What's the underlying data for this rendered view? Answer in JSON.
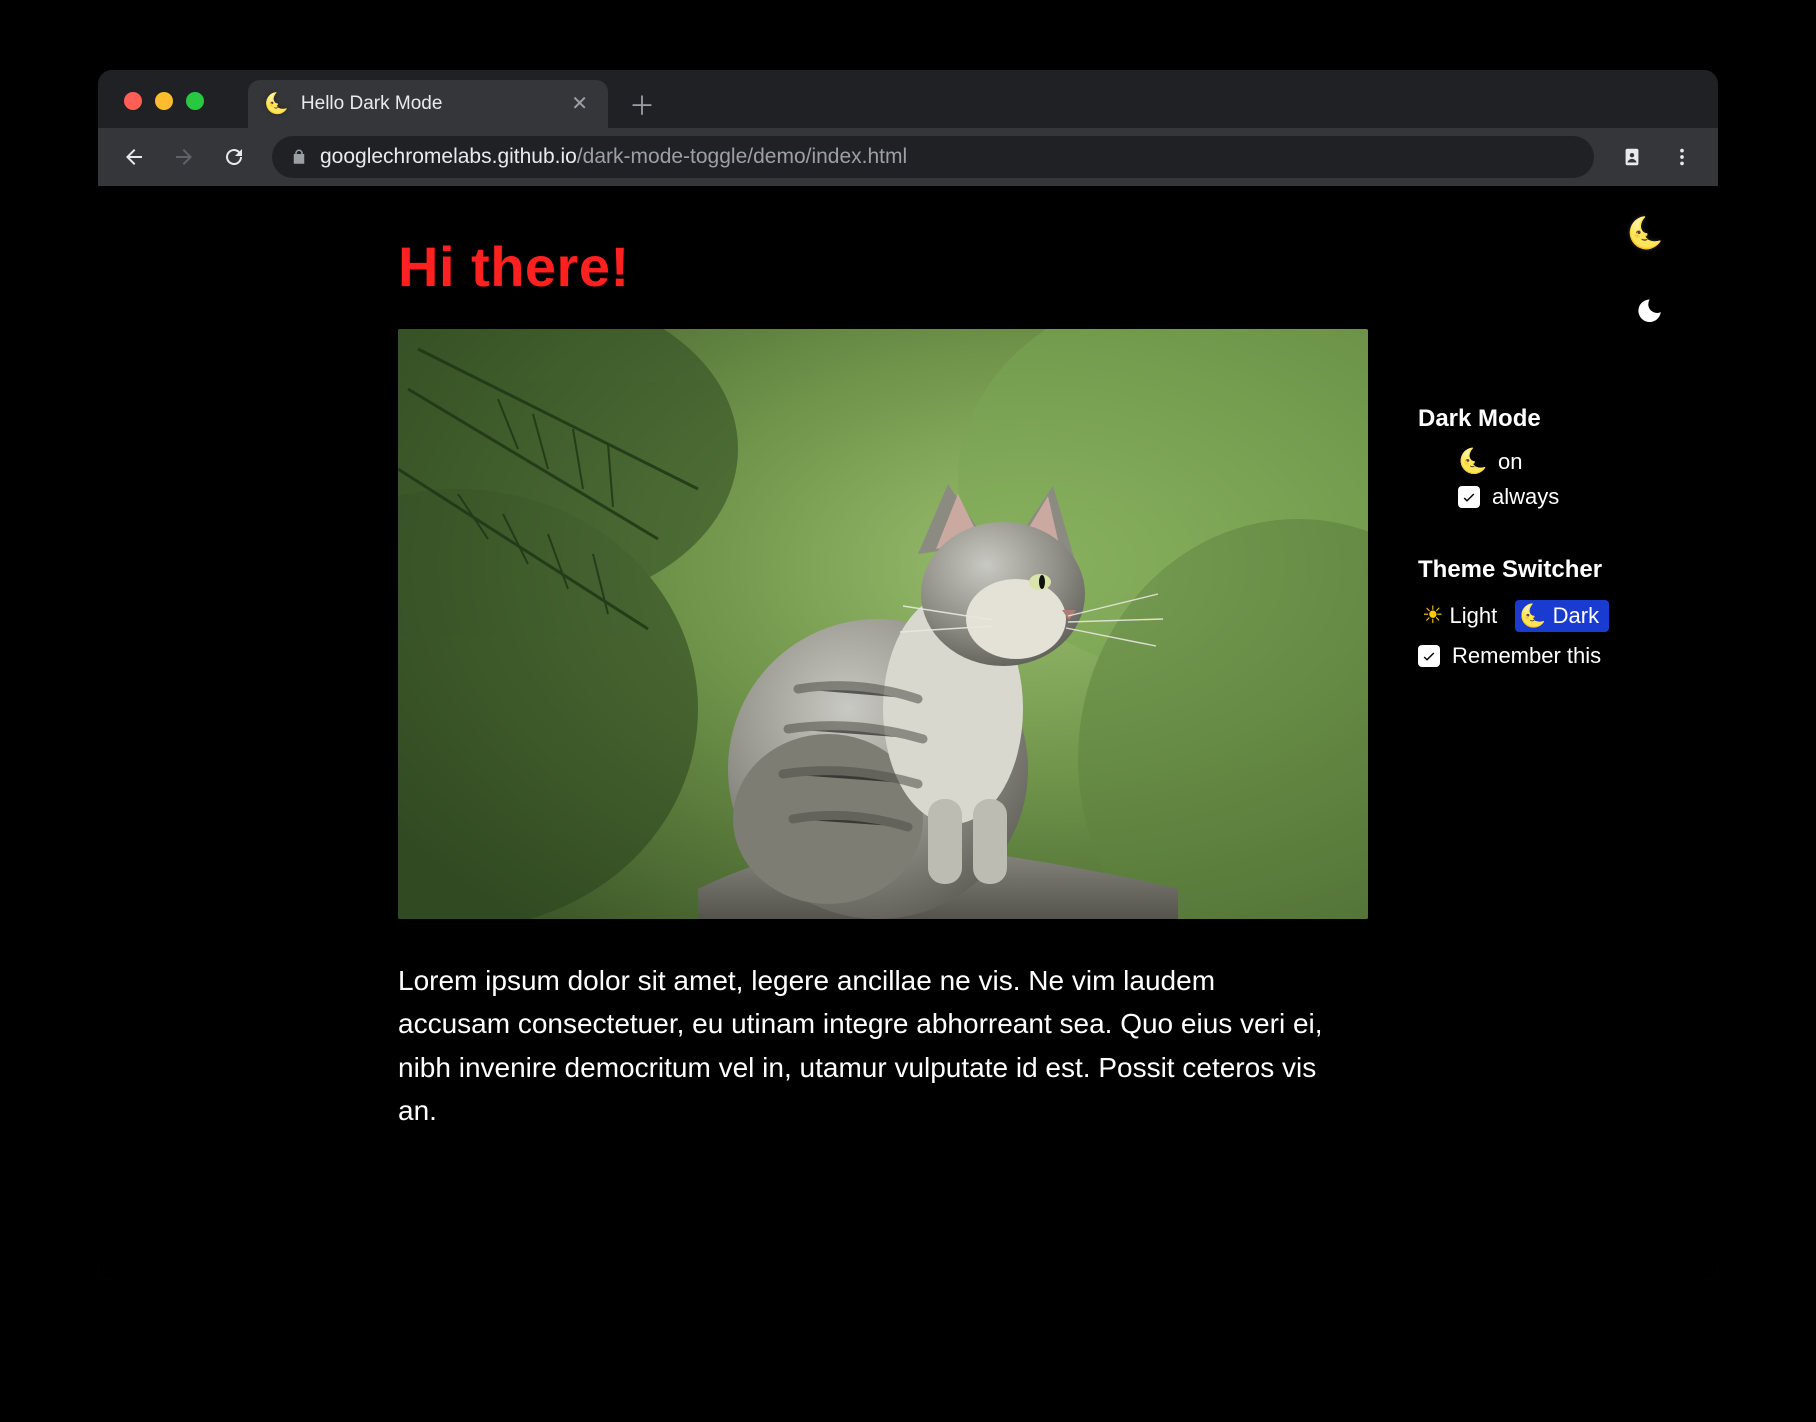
{
  "tab": {
    "title": "Hello Dark Mode",
    "favicon": "🌜"
  },
  "url": {
    "host": "googlechromelabs.github.io",
    "path": "/dark-mode-toggle/demo/index.html"
  },
  "page": {
    "heading": "Hi there!",
    "paragraph": "Lorem ipsum dolor sit amet, legere ancillae ne vis. Ne vim laudem accusam consectetuer, eu utinam integre abhorreant sea. Quo eius veri ei, nibh invenire democritum vel in, utamur vulputate id est. Possit ceteros vis an."
  },
  "controls": {
    "darkmode": {
      "title": "Dark Mode",
      "state_label": "on",
      "always_label": "always",
      "always_checked": true
    },
    "switcher": {
      "title": "Theme Switcher",
      "light_label": "Light",
      "dark_label": "Dark",
      "remember_label": "Remember this",
      "remember_checked": true
    }
  },
  "icons": {
    "moon": "🌜",
    "sun": "☀"
  }
}
